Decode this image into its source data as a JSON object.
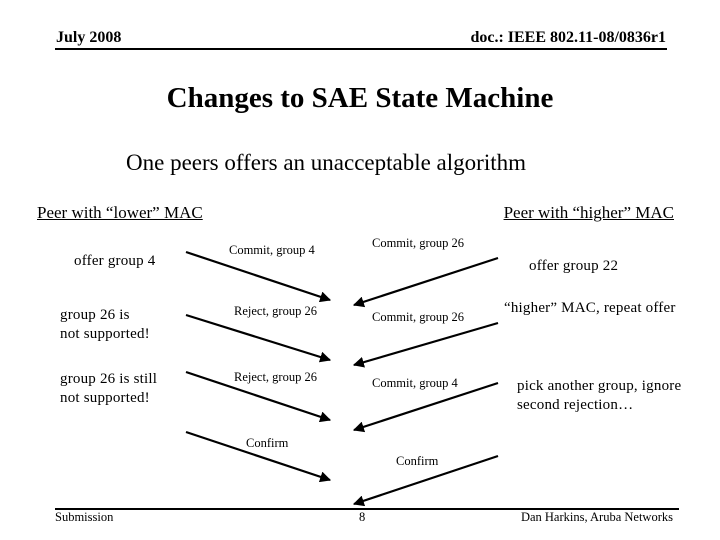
{
  "header": {
    "date": "July 2008",
    "doc_id": "doc.: IEEE 802.11-08/0836r1"
  },
  "slide": {
    "title": "Changes to SAE State Machine",
    "subtitle": "One peers offers an unacceptable algorithm"
  },
  "peers": {
    "lower": {
      "heading": "Peer with “lower” MAC",
      "notes": [
        {
          "lines": [
            "offer group 4"
          ]
        },
        {
          "lines": [
            "group 26 is",
            "not supported!"
          ]
        },
        {
          "lines": [
            "group 26 is still",
            "not supported!"
          ]
        }
      ]
    },
    "higher": {
      "heading": "Peer with “higher” MAC",
      "notes": [
        {
          "lines": [
            "offer group 22"
          ]
        },
        {
          "lines": [
            "“higher” MAC, repeat offer"
          ]
        },
        {
          "lines": [
            "pick another group, ignore",
            "second rejection…"
          ]
        }
      ]
    }
  },
  "messages": {
    "lower_to_higher": [
      {
        "label": "Commit, group 4"
      },
      {
        "label": "Reject, group 26"
      },
      {
        "label": "Reject, group 26"
      },
      {
        "label": "Confirm"
      }
    ],
    "higher_to_lower": [
      {
        "label": "Commit, group 26"
      },
      {
        "label": "Commit, group 26"
      },
      {
        "label": "Commit, group 4"
      },
      {
        "label": "Confirm"
      }
    ]
  },
  "footer": {
    "left": "Submission",
    "page_number": "8",
    "right": "Dan Harkins, Aruba Networks"
  }
}
